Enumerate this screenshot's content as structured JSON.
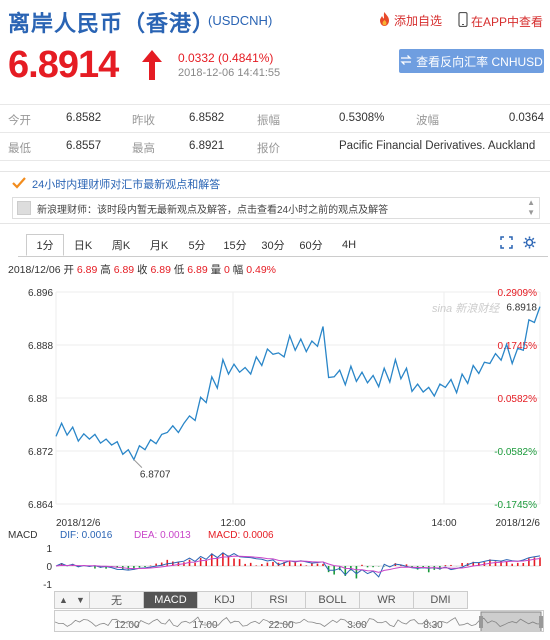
{
  "header": {
    "title": "离岸人民币（香港）",
    "code": "(USDCNH)",
    "add_watchlist": "添加自选",
    "view_in_app": "在APP中查看"
  },
  "quote": {
    "price": "6.8914",
    "change": "0.0332 (0.4841%)",
    "datetime": "2018-12-06 14:41:55",
    "reverse_button": "查看反向汇率 CNHUSD"
  },
  "stats": {
    "open_label": "今开",
    "open": "6.8582",
    "prev_close_label": "昨收",
    "prev_close": "6.8582",
    "amplitude_label": "振幅",
    "amplitude": "0.5308%",
    "range_label": "波幅",
    "range": "0.0364",
    "low_label": "最低",
    "low": "6.8557",
    "high_label": "最高",
    "high": "6.8921",
    "quoter_label": "报价",
    "quoter": "Pacific Financial Derivatives. Auckland"
  },
  "news": {
    "heading": "24小时内理财师对汇市最新观点和解答",
    "message": "新浪理财师：该时段内暂无最新观点及解答，点击查看24小时之前的观点及解答"
  },
  "tabs": [
    "1分",
    "日K",
    "周K",
    "月K",
    "5分",
    "15分",
    "30分",
    "60分",
    "4H"
  ],
  "info": {
    "date": "2018/12/06",
    "open_label": "开",
    "open": "6.89",
    "high_label": "高",
    "high": "6.89",
    "close_label": "收",
    "close": "6.89",
    "low_label": "低",
    "low": "6.89",
    "vol_label": "量",
    "vol": "0",
    "amp_label": "幅",
    "amp": "0.49%"
  },
  "chart_data": {
    "type": "line",
    "y_ticks": [
      "6.896",
      "6.888",
      "6.88",
      "6.872",
      "6.864"
    ],
    "ylim": [
      6.864,
      6.896
    ],
    "pct_ticks": [
      "0.2909%",
      "0.1745%",
      "0.0582%",
      "-0.0582%",
      "-0.1745%"
    ],
    "x_ticks": [
      "2018/12/6",
      "12:00",
      "14:00",
      "2018/12/6"
    ],
    "annotations": {
      "low": "6.8707",
      "last": "6.8918"
    },
    "watermark": "sina 新浪财经",
    "series": [
      {
        "values": [
          6.8742,
          6.8762,
          6.8744,
          6.8756,
          6.8735,
          6.8746,
          6.8738,
          6.8745,
          6.8732,
          6.8738,
          6.8729,
          6.8734,
          6.8715,
          6.8722,
          6.8707,
          6.8728,
          6.8722,
          6.8737,
          6.8731,
          6.8745,
          6.8748,
          6.8758,
          6.8748,
          6.8762,
          6.8773,
          6.8766,
          6.8801,
          6.8793,
          6.8832,
          6.8815,
          6.8858,
          6.8836,
          6.8851,
          6.8839,
          6.8846,
          6.8836,
          6.8862,
          6.8849,
          6.8874,
          6.8866,
          6.8868,
          6.8862,
          6.8894,
          6.8872,
          6.8889,
          6.887,
          6.8886,
          6.8878,
          6.8908,
          6.8831,
          6.8832,
          6.8842,
          6.882,
          6.8848,
          6.8825,
          6.8839,
          6.8823,
          6.8834,
          6.8817,
          6.8845,
          6.8824,
          6.8858,
          6.8829,
          6.8845,
          6.881,
          6.8821,
          6.8809,
          6.8816,
          6.8803,
          6.8821,
          6.8816,
          6.8828,
          6.8808,
          6.8836,
          6.8822,
          6.8849,
          6.8837,
          6.8854,
          6.8852,
          6.8867,
          6.8857,
          6.8881,
          6.8852,
          6.8875,
          6.8872,
          6.8918,
          6.8914,
          6.8938
        ]
      }
    ]
  },
  "macd": {
    "label": "MACD",
    "dif": "DIF: 0.0016",
    "dea": "DEA: 0.0013",
    "macd": "MACD: 0.0006",
    "y_ticks": [
      "1",
      "0",
      "-1"
    ]
  },
  "indicator_tabs": [
    "无",
    "MACD",
    "KDJ",
    "RSI",
    "BOLL",
    "WR",
    "DMI"
  ],
  "nav_buttons": {
    "up": "▲",
    "down": "▼"
  },
  "timeline_ticks": [
    "12:00",
    "17:00",
    "22:00",
    "3:00",
    "8:30"
  ],
  "colors": {
    "accent": "#2a64b4",
    "up": "#e51c23",
    "down": "#1a9a3a",
    "line": "#2a86c8"
  }
}
